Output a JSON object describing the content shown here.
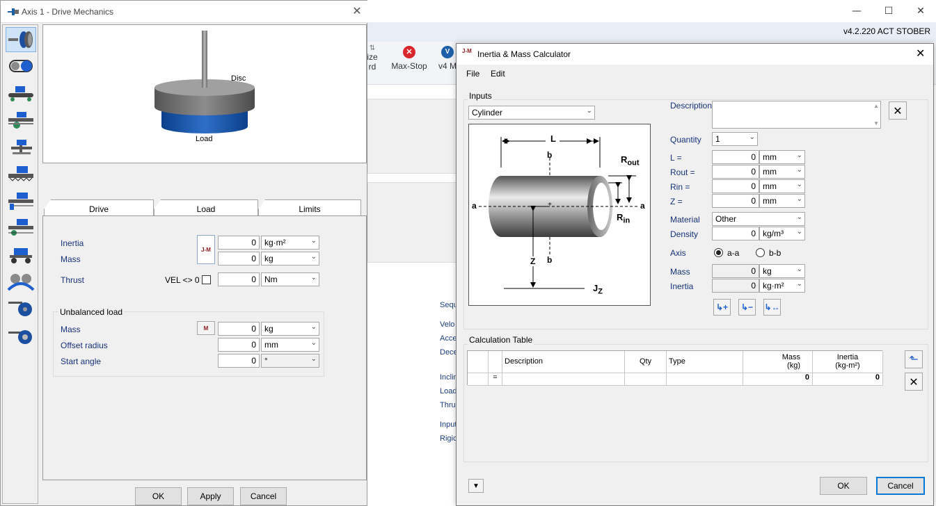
{
  "background_app": {
    "version": "v4.2.220 ACT STOBER",
    "ribbon": {
      "prev_label_1": "ize",
      "prev_label_2": "rd",
      "max_stop": "Max-Stop",
      "next_label": "v4 M"
    },
    "side_labels": [
      "Sequ",
      "Velo",
      "Acce",
      "Dece",
      "Inclin",
      "Load",
      "Thrus",
      "Input",
      "Rigic"
    ]
  },
  "drive_mechanics": {
    "title": "Axis 1 - Drive Mechanics",
    "preview": {
      "disc_label": "Disc",
      "load_label": "Load"
    },
    "tabs": [
      {
        "label": "Drive"
      },
      {
        "label": "Load"
      },
      {
        "label": "Limits"
      }
    ],
    "inertia": {
      "label": "Inertia",
      "value": "0",
      "unit": "kg·m²"
    },
    "mass": {
      "label": "Mass",
      "value": "0",
      "unit": "kg"
    },
    "thrust": {
      "label": "Thrust",
      "vel_label": "VEL <> 0",
      "value": "0",
      "unit": "Nm"
    },
    "jm_button": "J-M",
    "unbalanced": {
      "title": "Unbalanced load",
      "mass": {
        "label": "Mass",
        "value": "0",
        "unit": "kg"
      },
      "offset_radius": {
        "label": "Offset radius",
        "value": "0",
        "unit": "mm"
      },
      "start_angle": {
        "label": "Start angle",
        "value": "0",
        "unit": "°"
      },
      "m_button": "M"
    },
    "buttons": {
      "ok": "OK",
      "apply": "Apply",
      "cancel": "Cancel"
    }
  },
  "calculator": {
    "title": "Inertia & Mass Calculator",
    "icon_text": "J-M",
    "menu": [
      "File",
      "Edit"
    ],
    "inputs_title": "Inputs",
    "shape": "Cylinder",
    "diagram": {
      "L": "L",
      "b_top": "b",
      "b_bottom": "b",
      "a_left": "a",
      "a_right": "a",
      "rout_main": "R",
      "rout_sub": "out",
      "rin_main": "R",
      "rin_sub": "in",
      "z": "Z",
      "jz_main": "J",
      "jz_sub": "Z"
    },
    "description": {
      "label": "Description",
      "value": ""
    },
    "quantity": {
      "label": "Quantity",
      "value": "1"
    },
    "L": {
      "label": "L =",
      "value": "0",
      "unit": "mm"
    },
    "rout": {
      "label": "Rout =",
      "value": "0",
      "unit": "mm"
    },
    "rin": {
      "label": "Rin =",
      "value": "0",
      "unit": "mm"
    },
    "z": {
      "label": "Z =",
      "value": "0",
      "unit": "mm"
    },
    "material": {
      "label": "Material",
      "value": "Other"
    },
    "density": {
      "label": "Density",
      "value": "0",
      "unit": "kg/m³"
    },
    "axis": {
      "label": "Axis",
      "option_aa": "a-a",
      "option_bb": "b-b",
      "selected": "a-a"
    },
    "mass": {
      "label": "Mass",
      "value": "0",
      "unit": "kg"
    },
    "inertia": {
      "label": "Inertia",
      "value": "0",
      "unit": "kg·m²"
    },
    "table": {
      "title": "Calculation Table",
      "headers": [
        "",
        "",
        "Description",
        "Qty",
        "Type",
        "Mass",
        "Inertia"
      ],
      "header_units": [
        "",
        "",
        "",
        "",
        "",
        "(kg)",
        "(kg-m²)"
      ],
      "total_row": {
        "marker": "=",
        "description": "",
        "qty": "",
        "type": "",
        "mass": "0",
        "inertia": "0"
      }
    },
    "buttons": {
      "ok": "OK",
      "cancel": "Cancel"
    }
  }
}
